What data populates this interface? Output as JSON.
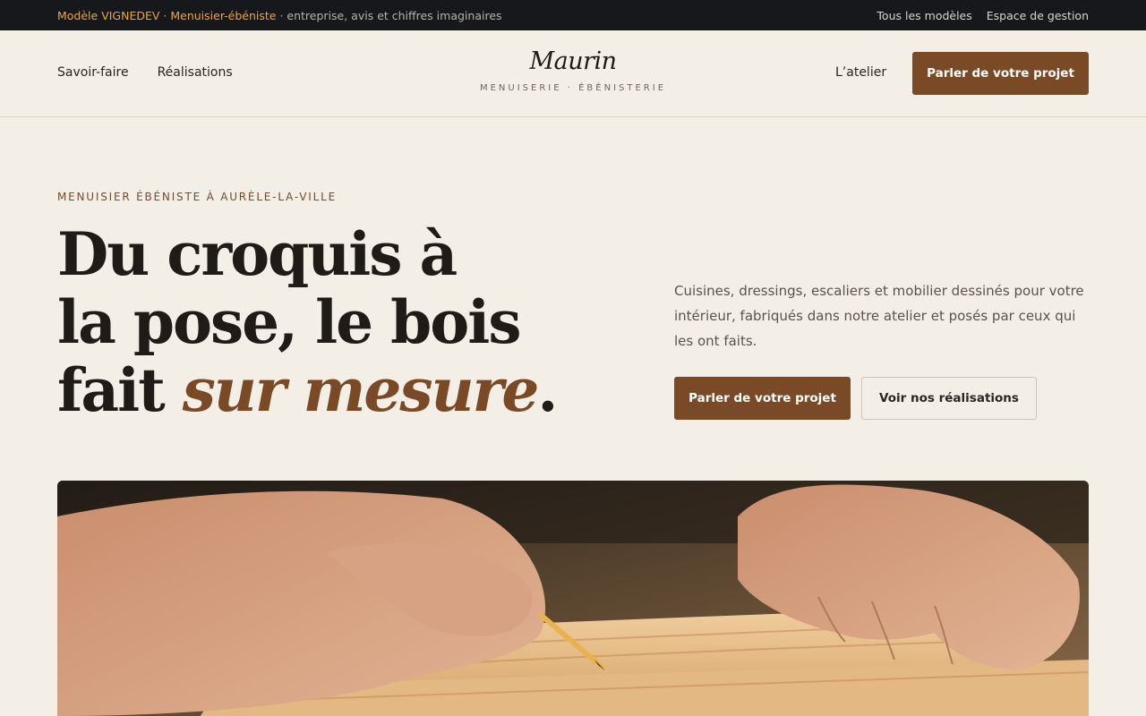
{
  "topbar": {
    "model_label": "Modèle VIGNEDEV · Menuisier-ébéniste",
    "tagline": " · entreprise, avis et chiffres imaginaires",
    "links": [
      "Tous les modèles",
      "Espace de gestion"
    ]
  },
  "header": {
    "nav_left": [
      "Savoir-faire",
      "Réalisations"
    ],
    "logo_name": "Maurin",
    "logo_sub": "MENUISERIE · ÉBÉNISTERIE",
    "nav_right": "L’atelier",
    "cta": "Parler de votre projet"
  },
  "hero": {
    "eyebrow": "MENUISIER ÉBÉNISTE À AURÈLE-LA-VILLE",
    "headline_line1": "Du croquis à",
    "headline_line2": "la pose, le bois",
    "headline_line3_start": "fait ",
    "headline_accent": "sur mesure",
    "headline_end": ".",
    "intro": "Cuisines, dressings, escaliers et mobilier dessinés pour votre intérieur, fabriqués dans notre atelier et posés par ceux qui les ont faits.",
    "cta_primary": "Parler de votre projet",
    "cta_secondary": "Voir nos réalisations"
  },
  "colors": {
    "accent": "#7a4a26",
    "topbar_bg": "#16181c",
    "topbar_highlight": "#f1a43a",
    "page_bg": "#f3efe6"
  },
  "image": {
    "description_icon": "hands-marking-wood-photo"
  }
}
